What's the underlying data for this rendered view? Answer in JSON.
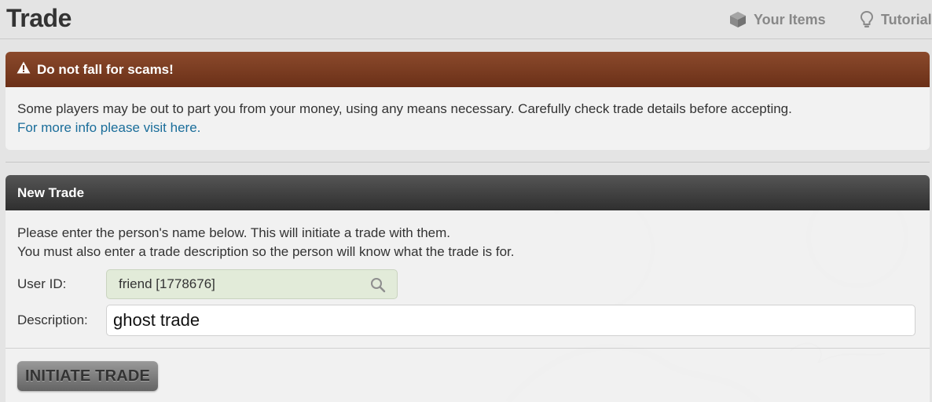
{
  "header": {
    "title": "Trade",
    "links": [
      {
        "label": "Your Items",
        "icon": "box-icon"
      },
      {
        "label": "Tutorial",
        "icon": "lightbulb-icon"
      }
    ]
  },
  "warning": {
    "title": "Do not fall for scams!",
    "icon": "warning-icon",
    "message": "Some players may be out to part you from your money, using any means necessary. Carefully check trade details before accepting.",
    "link_text": "For more info please visit here."
  },
  "new_trade": {
    "title": "New Trade",
    "intro_line1": "Please enter the person's name below. This will initiate a trade with them.",
    "intro_line2": "You must also enter a trade description so the person will know what the trade is for.",
    "user_id_label": "User ID:",
    "user_id_value": "friend [1778676]",
    "description_label": "Description:",
    "description_value": "ghost trade",
    "submit_label": "INITIATE TRADE"
  },
  "colors": {
    "warning_header": "#7a3b20",
    "trade_header": "#3a3a3a",
    "link": "#1a6d9a",
    "user_field_bg": "#e2ebd9"
  }
}
